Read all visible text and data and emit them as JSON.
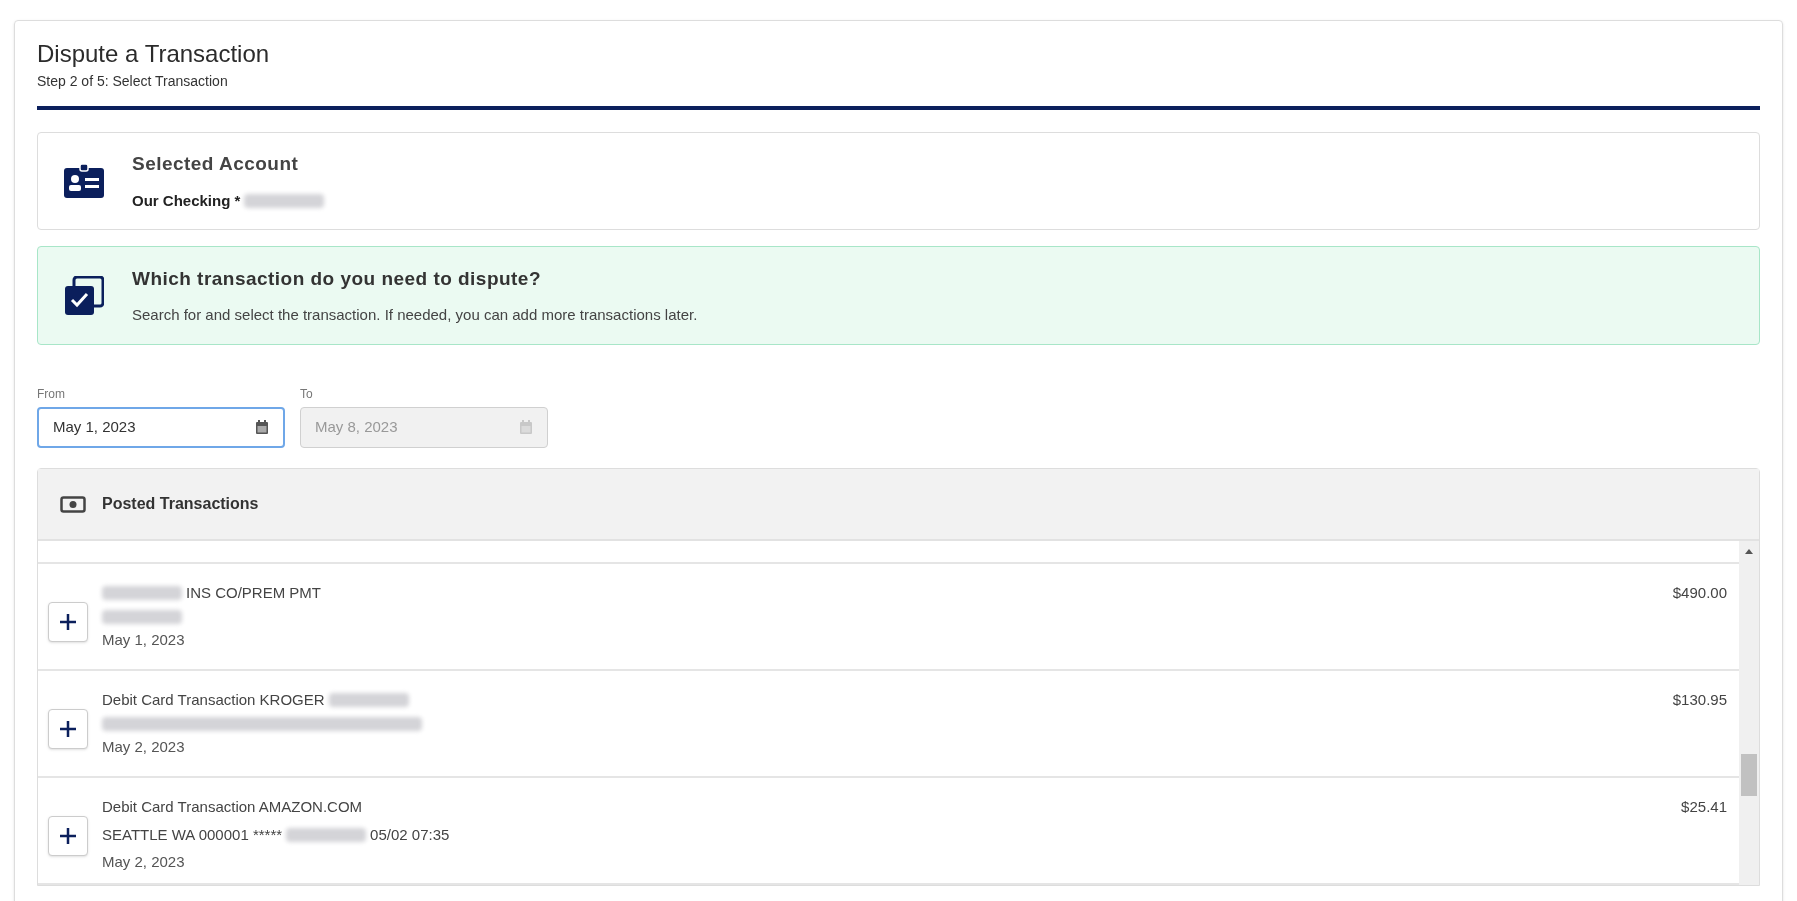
{
  "header": {
    "title": "Dispute a Transaction",
    "subtitle": "Step 2 of 5: Select Transaction"
  },
  "account_card": {
    "title": "Selected Account",
    "value": [
      {
        "kind": "text",
        "text": "Our Checking *"
      },
      {
        "kind": "redacted"
      }
    ]
  },
  "prompt_card": {
    "title": "Which transaction do you need to dispute?",
    "body": "Search for and select the transaction. If needed, you can add more transactions later."
  },
  "date_range": [
    {
      "label": "From",
      "value": "May 1, 2023",
      "disabled": false,
      "focused": true
    },
    {
      "label": "To",
      "value": "May 8, 2023",
      "disabled": true,
      "focused": false
    }
  ],
  "transactions": {
    "title": "Posted Transactions",
    "rows": [
      {
        "lines": [
          [
            {
              "kind": "redacted"
            },
            {
              "kind": "text",
              "text": "INS CO/PREM PMT"
            }
          ],
          [
            {
              "kind": "redacted"
            }
          ]
        ],
        "date": "May 1, 2023",
        "amount": "$490.00"
      },
      {
        "lines": [
          [
            {
              "kind": "text",
              "text": "Debit Card Transaction KROGER"
            },
            {
              "kind": "redacted"
            }
          ],
          [
            {
              "kind": "redacted",
              "wide": true
            }
          ]
        ],
        "date": "May 2, 2023",
        "amount": "$130.95"
      },
      {
        "lines": [
          [
            {
              "kind": "text",
              "text": "Debit Card Transaction AMAZON.COM"
            }
          ],
          [
            {
              "kind": "text",
              "text": "SEATTLE WA 000001 *****"
            },
            {
              "kind": "redacted"
            },
            {
              "kind": "text",
              "text": "05/02 07:35"
            }
          ]
        ],
        "date": "May 2, 2023",
        "amount": "$25.41"
      }
    ]
  }
}
